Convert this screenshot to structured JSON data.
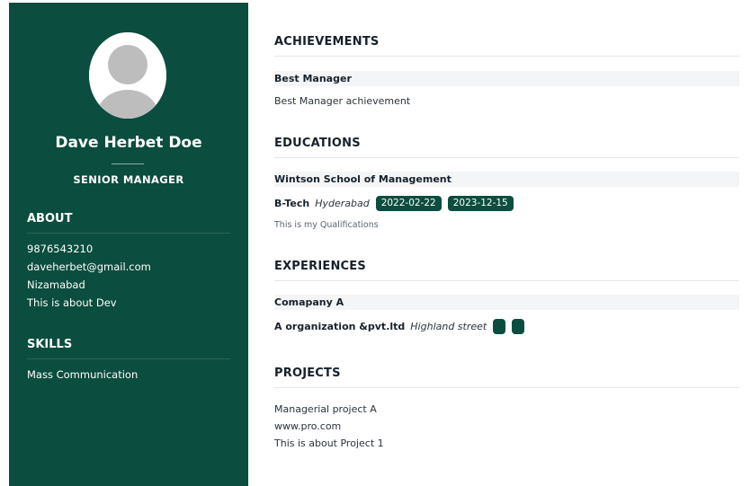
{
  "profile": {
    "name": "Dave Herbet Doe",
    "title": "SENIOR MANAGER"
  },
  "about": {
    "heading": "ABOUT",
    "lines": [
      "9876543210",
      "daveherbet@gmail.com",
      "Nizamabad",
      "This is about Dev"
    ]
  },
  "skills": {
    "heading": "SKILLS",
    "items": [
      "Mass Communication"
    ]
  },
  "achievements": {
    "heading": "ACHIEVEMENTS",
    "items": [
      {
        "title": "Best Manager",
        "description": "Best Manager achievement"
      }
    ]
  },
  "educations": {
    "heading": "EDUCATIONS",
    "items": [
      {
        "school": "Wintson School of Management",
        "degree": "B-Tech",
        "location": "Hyderabad",
        "start": "2022-02-22",
        "end": "2023-12-15",
        "description": "This is my Qualifications"
      }
    ]
  },
  "experiences": {
    "heading": "EXPERIENCES",
    "items": [
      {
        "company": "Comapany A",
        "organization": "A organization &pvt.ltd",
        "location": "Highland street",
        "start": "",
        "end": ""
      }
    ]
  },
  "projects": {
    "heading": "PROJECTS",
    "items": [
      {
        "name": "Managerial project A",
        "url": "www.pro.com",
        "description": "This is about Project 1"
      }
    ]
  },
  "colors": {
    "sidebar": "#0b4d3e",
    "badge": "#0b4d3e",
    "avatar_placeholder": "#bdbdbd"
  }
}
